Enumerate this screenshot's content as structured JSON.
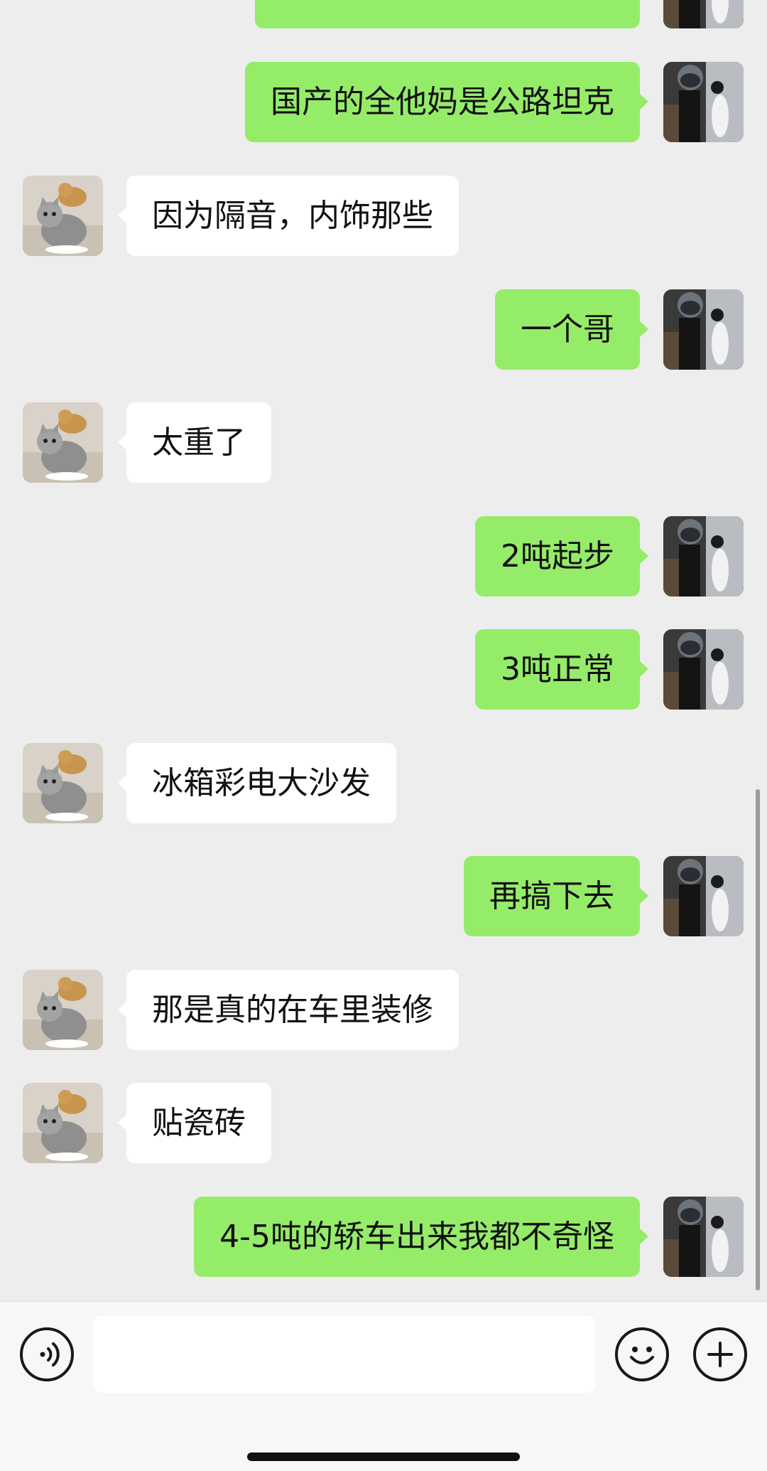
{
  "messages": [
    {
      "side": "right",
      "text": "",
      "partial": true
    },
    {
      "side": "right",
      "text": "国产的全他妈是公路坦克"
    },
    {
      "side": "left",
      "text": "因为隔音，内饰那些"
    },
    {
      "side": "right",
      "text": "一个哥"
    },
    {
      "side": "left",
      "text": "太重了"
    },
    {
      "side": "right",
      "text": "2吨起步"
    },
    {
      "side": "right",
      "text": "3吨正常"
    },
    {
      "side": "left",
      "text": "冰箱彩电大沙发"
    },
    {
      "side": "right",
      "text": "再搞下去"
    },
    {
      "side": "left",
      "text": "那是真的在车里装修"
    },
    {
      "side": "left",
      "text": "贴瓷砖"
    },
    {
      "side": "right",
      "text": "4-5吨的轿车出来我都不奇怪"
    }
  ],
  "input": {
    "voice_icon": "voice-icon",
    "emoji_icon": "emoji-icon",
    "plus_icon": "plus-icon",
    "value": ""
  },
  "colors": {
    "background": "#ededed",
    "outgoing_bubble": "#95ec69",
    "incoming_bubble": "#ffffff",
    "input_bar": "#f7f7f7"
  }
}
